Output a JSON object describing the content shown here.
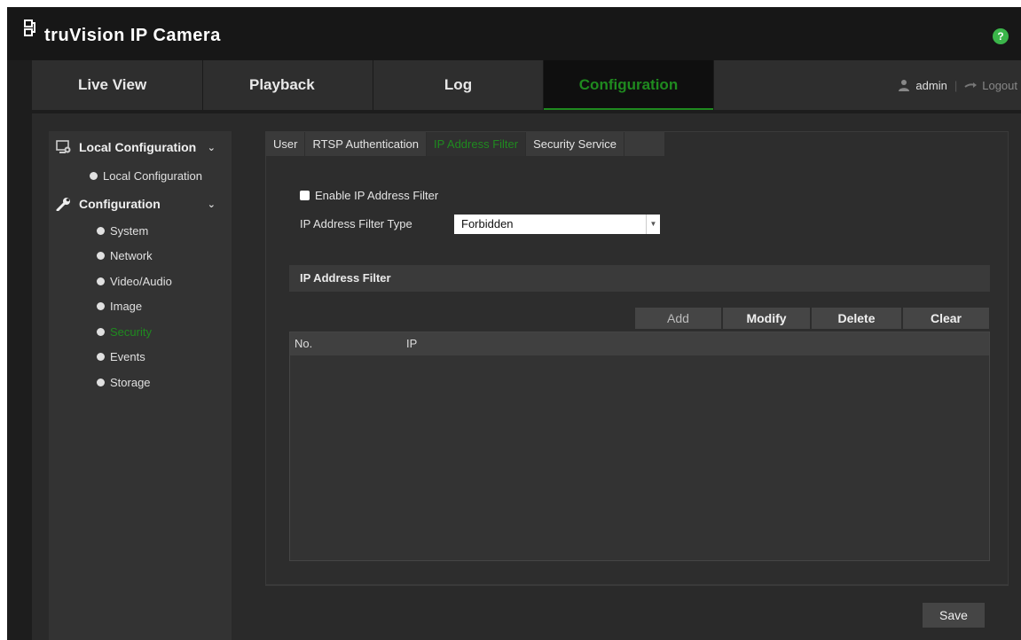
{
  "app": {
    "title": "truVision IP Camera",
    "help_label": "?"
  },
  "nav": {
    "tabs": [
      {
        "label": "Live View"
      },
      {
        "label": "Playback"
      },
      {
        "label": "Log"
      },
      {
        "label": "Configuration"
      }
    ],
    "active_tab": "Configuration",
    "user": "admin",
    "separator": "|",
    "logout": "Logout"
  },
  "sidebar": {
    "groups": [
      {
        "label": "Local Configuration",
        "icon": "local-config-icon",
        "items": [
          {
            "label": "Local Configuration"
          }
        ]
      },
      {
        "label": "Configuration",
        "icon": "wrench-icon",
        "items": [
          {
            "label": "System"
          },
          {
            "label": "Network"
          },
          {
            "label": "Video/Audio"
          },
          {
            "label": "Image"
          },
          {
            "label": "Security"
          },
          {
            "label": "Events"
          },
          {
            "label": "Storage"
          }
        ]
      }
    ],
    "active_item": "Security",
    "chevron": "⌄"
  },
  "subtabs": {
    "items": [
      {
        "label": "User"
      },
      {
        "label": "RTSP Authentication"
      },
      {
        "label": "IP Address Filter"
      },
      {
        "label": "Security Service"
      }
    ],
    "active": "IP Address Filter"
  },
  "form": {
    "enable_label": "Enable IP Address Filter",
    "enable_checked": false,
    "type_label": "IP Address Filter Type",
    "type_value": "Forbidden",
    "type_arrow": "▼"
  },
  "section": {
    "title": "IP Address Filter"
  },
  "buttons": {
    "add": "Add",
    "modify": "Modify",
    "delete": "Delete",
    "clear": "Clear",
    "save": "Save"
  },
  "table": {
    "columns": [
      "No.",
      "IP"
    ],
    "rows": []
  },
  "colors": {
    "accent": "#1f8a1f",
    "help": "#3bb54a",
    "background": "#1d1d1d"
  }
}
